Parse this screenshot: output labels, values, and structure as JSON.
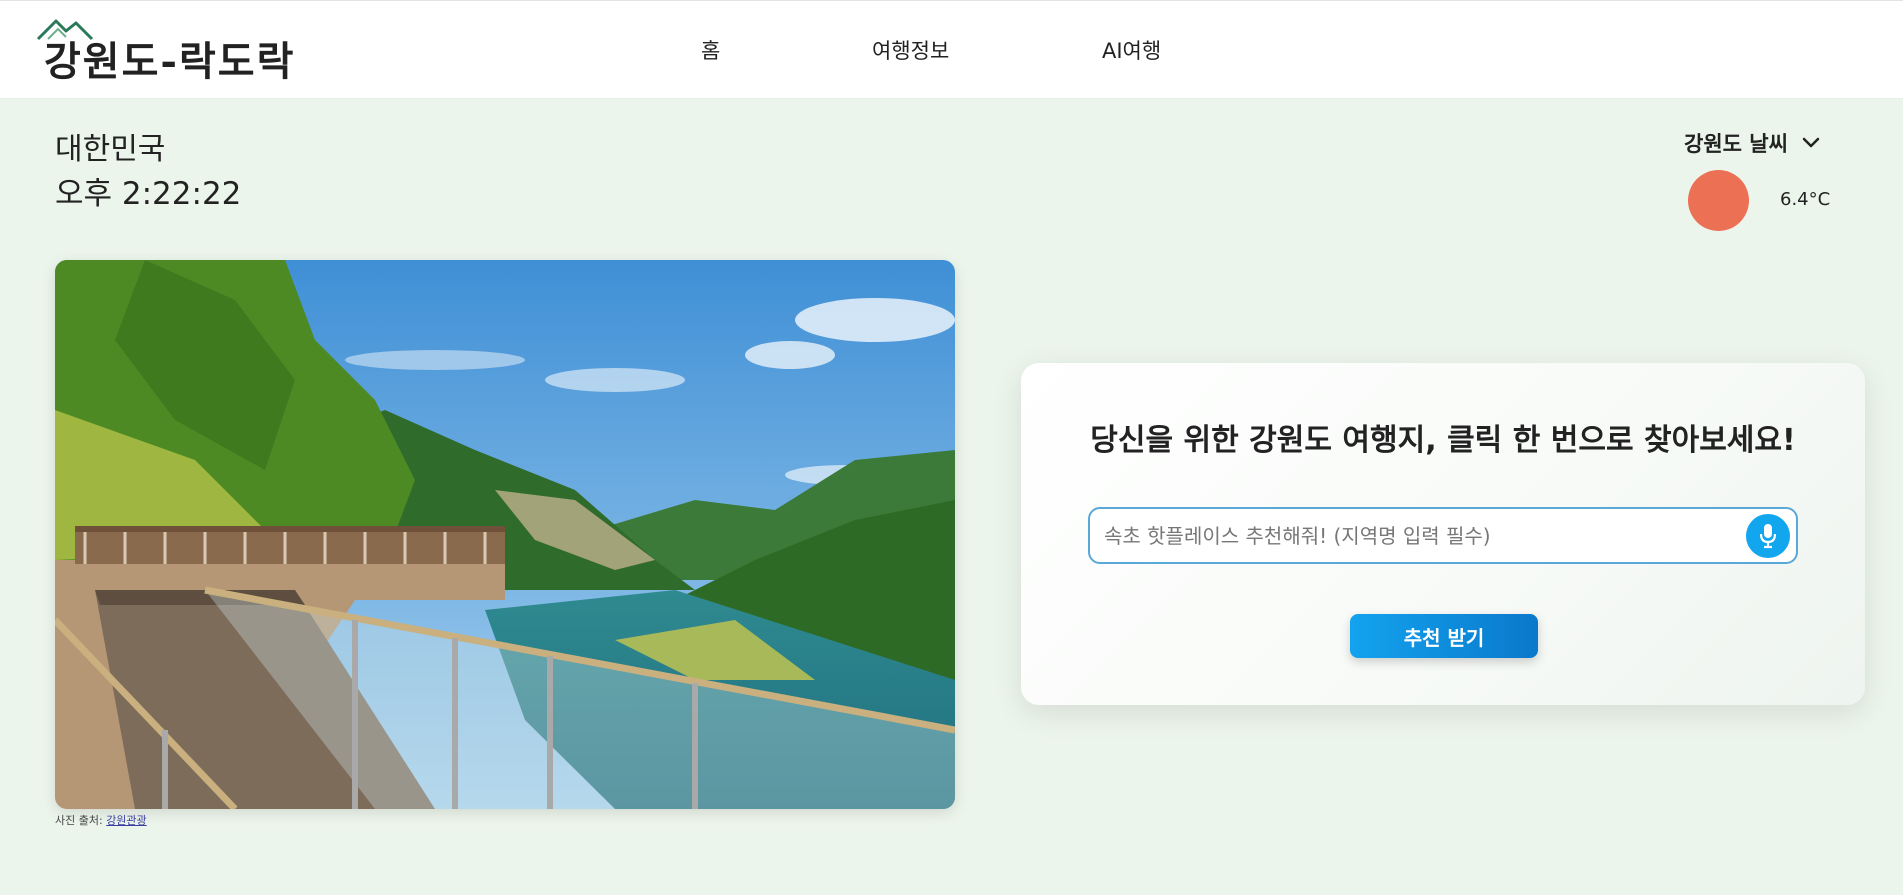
{
  "header": {
    "logo_text": "강원도-락도락",
    "nav": [
      {
        "label": "홈"
      },
      {
        "label": "여행정보"
      },
      {
        "label": "AI여행"
      }
    ]
  },
  "location": {
    "country": "대한민국",
    "time": "오후 2:22:22"
  },
  "weather": {
    "dropdown_label": "강원도 날씨",
    "temperature": "6.4°C",
    "icon": "sun-icon",
    "sun_color": "#ec7053"
  },
  "photo": {
    "credit_prefix": "사진 출처:",
    "credit_source": "강원관광"
  },
  "recommend": {
    "title": "당신을 위한 강원도 여행지, 클릭 한 번으로 찾아보세요!",
    "input_placeholder": "속초 핫플레이스 추천해줘! (지역명 입력 필수)",
    "mic_icon": "microphone-icon",
    "submit_label": "추천 받기"
  },
  "colors": {
    "page_background": "#ecf5ec",
    "accent": "#12a6ef",
    "accent_dark": "#0a78cc"
  }
}
